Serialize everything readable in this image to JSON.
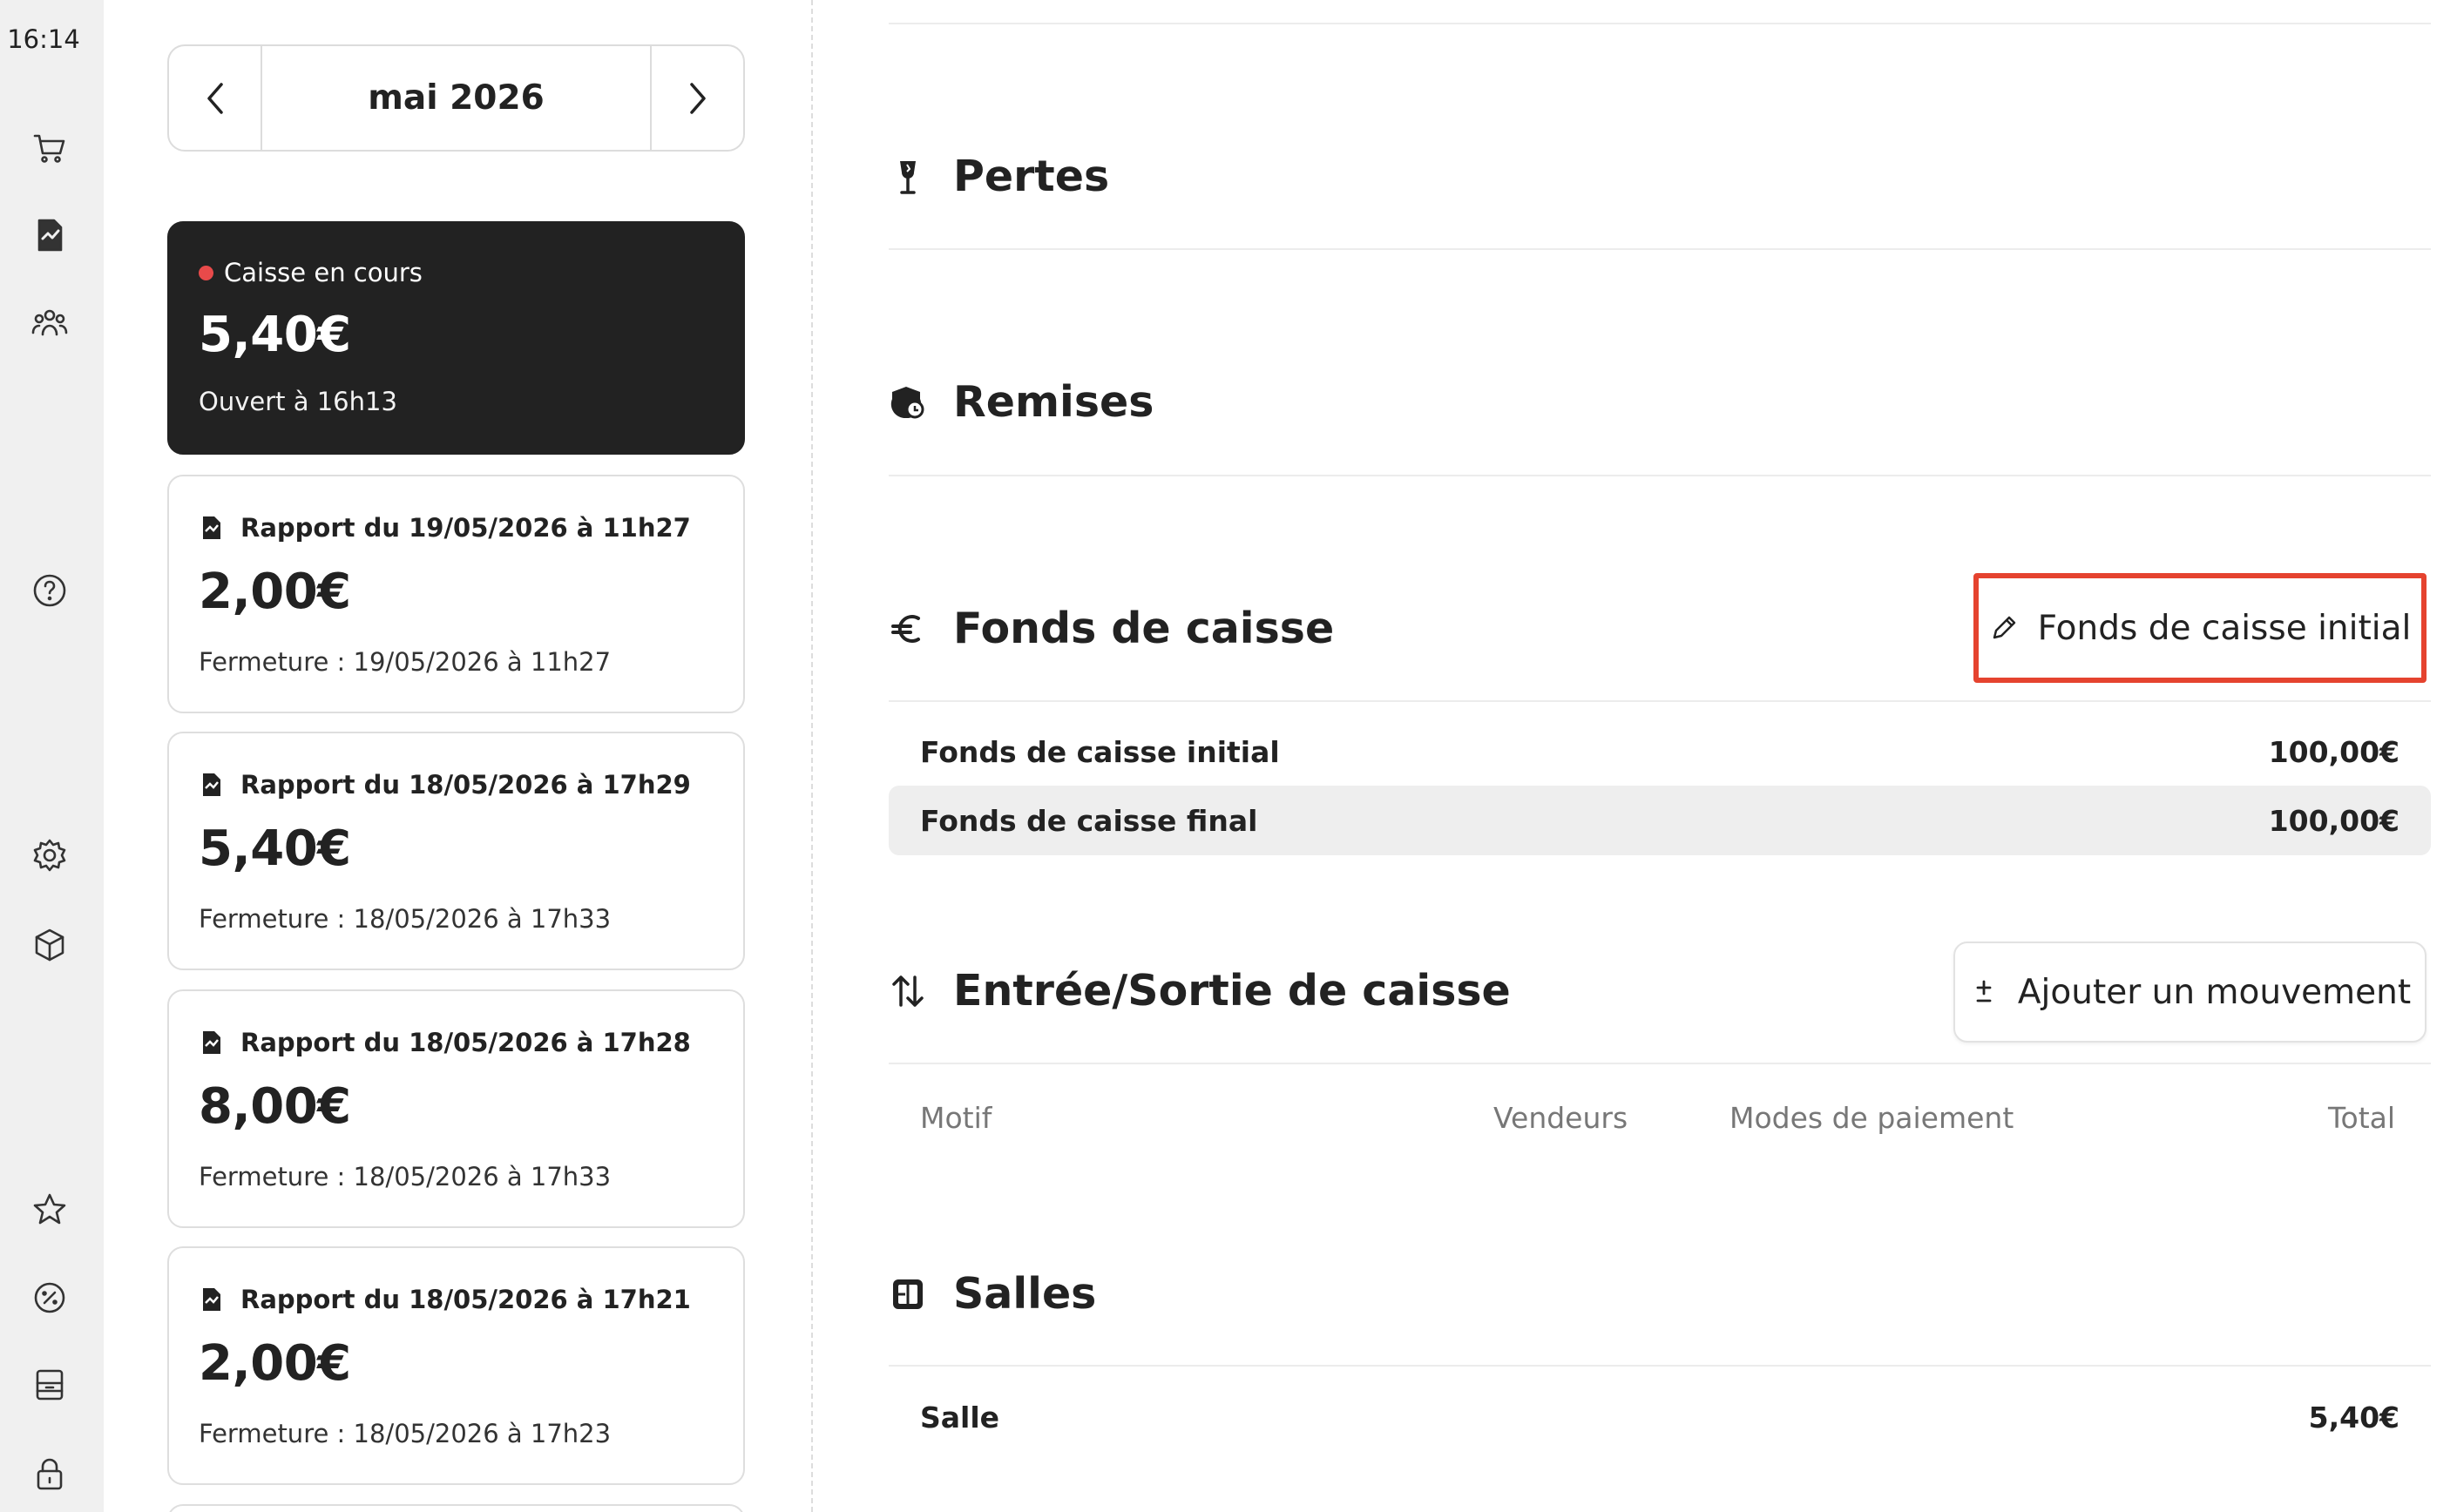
{
  "rail": {
    "time": "16:14",
    "icons": [
      "cart-icon",
      "report-icon",
      "users-icon",
      "help-icon",
      "settings-icon",
      "integrations-icon",
      "star-icon",
      "discount-icon",
      "register-icon",
      "lock-icon"
    ]
  },
  "month_nav": {
    "label": "mai 2026"
  },
  "current_register": {
    "status": "Caisse en cours",
    "amount": "5,40€",
    "opened": "Ouvert à 16h13",
    "status_color": "#e84a4a"
  },
  "reports": [
    {
      "title": "Rapport du 19/05/2026 à 11h27",
      "amount": "2,00€",
      "closing": "Fermeture : 19/05/2026 à 11h27"
    },
    {
      "title": "Rapport du 18/05/2026 à 17h29",
      "amount": "5,40€",
      "closing": "Fermeture : 18/05/2026 à 17h33"
    },
    {
      "title": "Rapport du 18/05/2026 à 17h28",
      "amount": "8,00€",
      "closing": "Fermeture : 18/05/2026 à 17h33"
    },
    {
      "title": "Rapport du 18/05/2026 à 17h21",
      "amount": "2,00€",
      "closing": "Fermeture : 18/05/2026 à 17h23"
    }
  ],
  "sections": {
    "pertes": {
      "title": "Pertes",
      "icon": "glass-icon"
    },
    "remises": {
      "title": "Remises",
      "icon": "discount-tag-icon"
    },
    "fonds": {
      "title": "Fonds de caisse",
      "icon": "euro-icon",
      "button": "Fonds de caisse initial",
      "rows": [
        {
          "label": "Fonds de caisse initial",
          "value": "100,00€"
        },
        {
          "label": "Fonds de caisse final",
          "value": "100,00€"
        }
      ]
    },
    "mouvements": {
      "title": "Entrée/Sortie de caisse",
      "icon": "arrows-updown-icon",
      "button": "Ajouter un mouvement",
      "columns": {
        "motif": "Motif",
        "vendeurs": "Vendeurs",
        "modes": "Modes de paiement",
        "total": "Total"
      }
    },
    "salles": {
      "title": "Salles",
      "icon": "room-icon",
      "rows": [
        {
          "label": "Salle",
          "value": "5,40€"
        }
      ]
    }
  },
  "colors": {
    "highlight": "#e5432f",
    "dark_card": "#222222",
    "rail_bg": "#f0f0f0"
  }
}
